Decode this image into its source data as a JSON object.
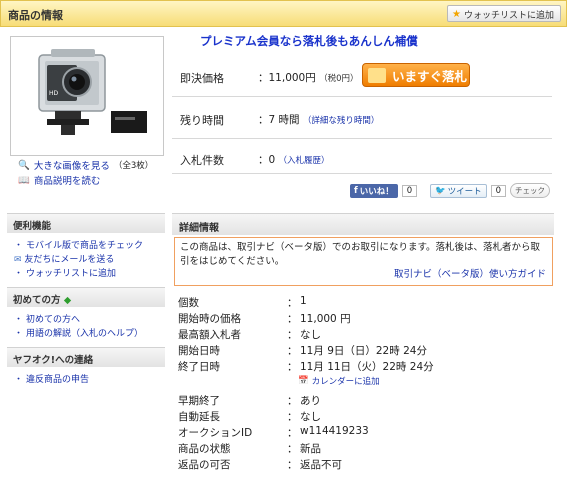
{
  "header": {
    "title": "商品の情報",
    "watchlist_button": "ウォッチリストに追加"
  },
  "product": {
    "image_alt": "アクションカメラ",
    "links": [
      {
        "label": "大きな画像を見る",
        "extra": "（全3枚）"
      },
      {
        "label": "商品説明を読む"
      }
    ]
  },
  "promo": "プレミアム会員なら落札後もあんしん補償",
  "buy_now": {
    "label": "即決価格",
    "value": "11,000円",
    "tax": "（税0円）",
    "button": "いますぐ落札"
  },
  "remaining": {
    "label": "残り時間",
    "value": "7 時間",
    "link": "（詳細な残り時間）"
  },
  "bids": {
    "label": "入札件数",
    "value": "0",
    "link": "（入札履歴）"
  },
  "social": {
    "like_label": "いいね！",
    "like_count": "0",
    "tweet_label": "ツイート",
    "tweet_count": "0",
    "check_label": "チェック"
  },
  "sidebar": {
    "sections": [
      {
        "title": "便利機能",
        "items": [
          "モバイル版で商品をチェック",
          "友だちにメールを送る",
          "ウォッチリストに追加"
        ]
      },
      {
        "title": "初めての方",
        "items": [
          "初めての方へ",
          "用語の解説（入札のヘルプ）"
        ]
      },
      {
        "title": "ヤフオク!への連絡",
        "items": [
          "違反商品の申告"
        ]
      }
    ]
  },
  "details": {
    "title": "詳細情報",
    "notice": "この商品は、取引ナビ（ベータ版）でのお取引になります。落札後は、落札者から取引をはじめてください。",
    "notice_link": "取引ナビ（ベータ版）使い方ガイド",
    "calendar_link": "カレンダーに追加",
    "rows": [
      {
        "label": "個数",
        "value": "1"
      },
      {
        "label": "開始時の価格",
        "value": "11,000 円"
      },
      {
        "label": "最高額入札者",
        "value": "なし"
      },
      {
        "label": "開始日時",
        "value": "11月 9日（日）22時 24分"
      },
      {
        "label": "終了日時",
        "value": "11月 11日（火）22時 24分"
      },
      {
        "label": "早期終了",
        "value": "あり"
      },
      {
        "label": "自動延長",
        "value": "なし"
      },
      {
        "label": "オークションID",
        "value": "w114419233"
      },
      {
        "label": "商品の状態",
        "value": "新品"
      },
      {
        "label": "返品の可否",
        "value": "返品不可"
      }
    ]
  },
  "colors": {
    "accent_orange": "#ef7d00",
    "link_blue": "#1a33aa",
    "header_yellow": "#f7dd77"
  }
}
